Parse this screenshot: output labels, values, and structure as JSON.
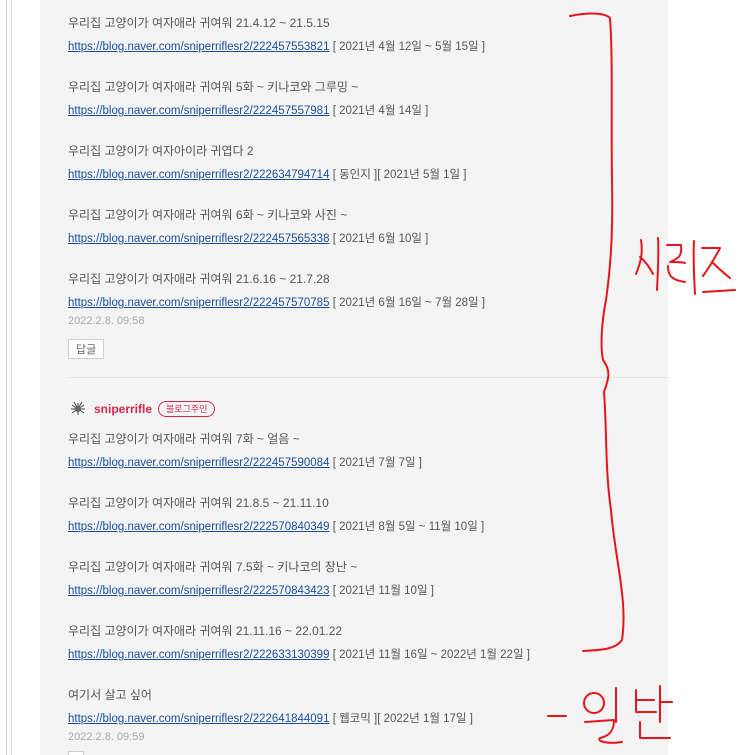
{
  "comment_1": {
    "entries": [
      {
        "title": "우리집 고양이가 여자애라 귀여워 21.4.12 ~ 21.5.15",
        "url": "https://blog.naver.com/sniperriflesr2/222457553821",
        "suffix": "[ 2021년 4월 12일 ~ 5월 15일 ]"
      },
      {
        "title": "우리집 고양이가 여자애라 귀여워 5화 ~ 키나코와 그루밍 ~",
        "url": "https://blog.naver.com/sniperriflesr2/222457557981",
        "suffix": "[ 2021년 4월 14일 ]"
      },
      {
        "title": "우리집 고양이가 여자아이라 귀엽다 2",
        "url": "https://blog.naver.com/sniperriflesr2/222634794714",
        "suffix": "[ 동인지 ][ 2021년 5월 1일 ]"
      },
      {
        "title": "우리집 고양이가 여자애라 귀여워 6화 ~ 키나코와 사진 ~",
        "url": "https://blog.naver.com/sniperriflesr2/222457565338",
        "suffix": "[ 2021년 6월 10일 ]"
      },
      {
        "title": "우리집 고양이가 여자애라 귀여워 21.6.16 ~ 21.7.28",
        "url": "https://blog.naver.com/sniperriflesr2/222457570785",
        "suffix": "[ 2021년 6월 16일 ~ 7월 28일 ]"
      }
    ],
    "timestamp": "2022.2.8. 09:58",
    "reply_label": "답글"
  },
  "comment_2": {
    "author": "sniperrifle",
    "badge": "블로그주인",
    "entries": [
      {
        "title": "우리집 고양이가 여자애라 귀여워 7화 ~ 얼음 ~",
        "url": "https://blog.naver.com/sniperriflesr2/222457590084",
        "suffix": "[ 2021년 7월 7일 ]"
      },
      {
        "title": "우리집 고양이가 여자애라 귀여워 21.8.5 ~ 21.11.10",
        "url": "https://blog.naver.com/sniperriflesr2/222570840349",
        "suffix": "[ 2021년 8월 5일 ~ 11월 10일 ]"
      },
      {
        "title": "우리집 고양이가 여자애라 귀여워 7.5화 ~ 키나코의 장난 ~",
        "url": "https://blog.naver.com/sniperriflesr2/222570843423",
        "suffix": "[ 2021년 11월 10일 ]"
      },
      {
        "title": "우리집 고양이가 여자애라 귀여워 21.11.16 ~ 22.01.22",
        "url": "https://blog.naver.com/sniperriflesr2/222633130399",
        "suffix": "[ 2021년 11월 16일 ~ 2022년 1월 22일 ]"
      },
      {
        "title": "여기서 살고 싶어",
        "url": "https://blog.naver.com/sniperriflesr2/222641844091",
        "suffix": "[ 웹코믹 ][ 2022년 1월 17일 ]"
      }
    ],
    "timestamp": "2022.2.8. 09:59"
  },
  "annotations": {
    "series_label": "시리즈",
    "general_label": "일반",
    "ink_color": "#e8141b"
  },
  "colors": {
    "link": "#1a4f9c",
    "author": "#d3294f",
    "panel_bg": "#f4f4f4"
  }
}
